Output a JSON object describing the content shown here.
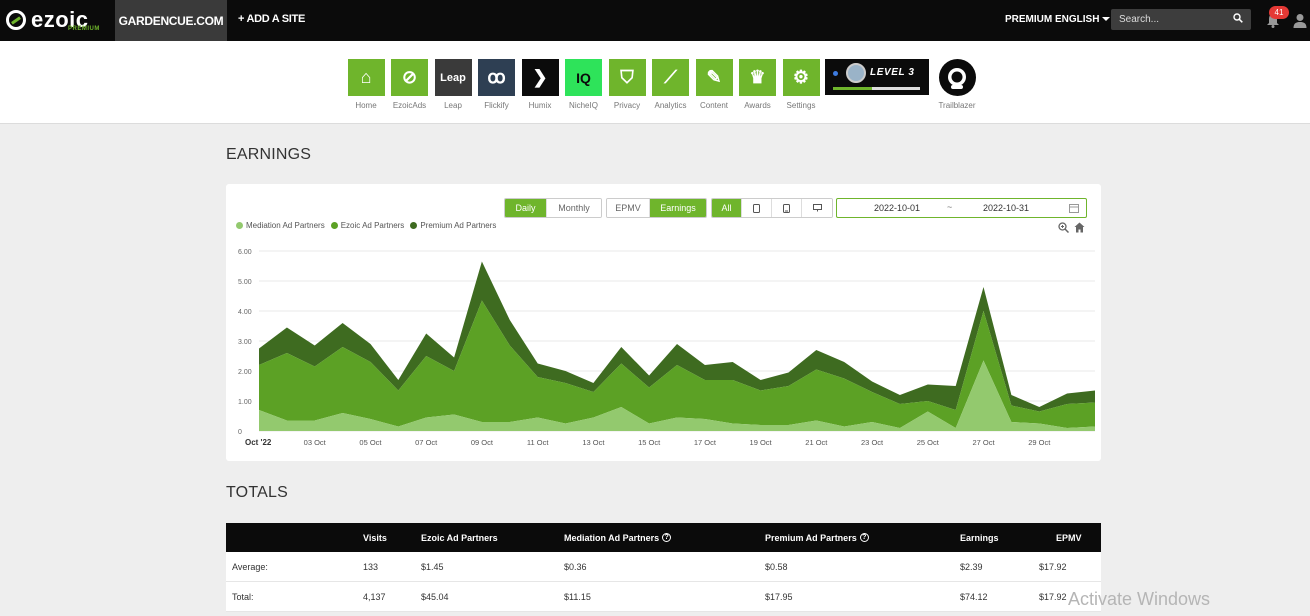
{
  "topnav": {
    "logo": "ezoic",
    "logo_sub": "PREMIUM",
    "site": "GARDENCUE.COM",
    "add_site": "+ ADD A SITE",
    "premium": "PREMIUM",
    "language": "ENGLISH",
    "search_placeholder": "Search...",
    "notification_count": "41"
  },
  "apps": [
    {
      "name": "home",
      "label": "Home",
      "glyph": "⌂",
      "bg": "#6fb52c"
    },
    {
      "name": "ezoicads",
      "label": "EzoicAds",
      "glyph": "⊘",
      "bg": "#6fb52c"
    },
    {
      "name": "leap",
      "label": "Leap",
      "glyph": "Leap",
      "bg": "#3a3a3a"
    },
    {
      "name": "flickify",
      "label": "Flickify",
      "glyph": "ꝏ",
      "bg": "#2e3f53"
    },
    {
      "name": "humix",
      "label": "Humix",
      "glyph": "❯",
      "bg": "#0b0b0b"
    },
    {
      "name": "nicheiq",
      "label": "NicheIQ",
      "glyph": "IQ",
      "bg": "#2ee35a"
    },
    {
      "name": "privacy",
      "label": "Privacy",
      "glyph": "⛉",
      "bg": "#6fb52c"
    },
    {
      "name": "analytics",
      "label": "Analytics",
      "glyph": "⟋",
      "bg": "#6fb52c"
    },
    {
      "name": "content",
      "label": "Content",
      "glyph": "✎",
      "bg": "#6fb52c"
    },
    {
      "name": "awards",
      "label": "Awards",
      "glyph": "♛",
      "bg": "#6fb52c"
    },
    {
      "name": "settings",
      "label": "Settings",
      "glyph": "⚙",
      "bg": "#6fb52c"
    }
  ],
  "level": {
    "text": "LEVEL 3",
    "progress": 0.45
  },
  "trailblazer": {
    "label": "Trailblazer"
  },
  "earnings_heading": "EARNINGS",
  "totals_heading": "TOTALS",
  "controls": {
    "period": [
      {
        "label": "Daily",
        "active": true
      },
      {
        "label": "Monthly",
        "active": false
      }
    ],
    "metric": [
      {
        "label": "EPMV",
        "active": false
      },
      {
        "label": "Earnings",
        "active": true
      }
    ],
    "device": [
      {
        "label": "All",
        "active": true
      },
      {
        "label": "tablet-icon",
        "active": false
      },
      {
        "label": "mobile-icon",
        "active": false
      },
      {
        "label": "desktop-icon",
        "active": false
      }
    ],
    "date_from": "2022-10-01",
    "date_sep": "~",
    "date_to": "2022-10-31"
  },
  "colors": {
    "brand_green": "#6fb52c",
    "mediation": "#93c96e",
    "ezoic": "#5ca125",
    "premium": "#3e6b20"
  },
  "chart_data": {
    "type": "area",
    "stacked": true,
    "x": [
      "2022-10-01",
      "2022-10-02",
      "2022-10-03",
      "2022-10-04",
      "2022-10-05",
      "2022-10-06",
      "2022-10-07",
      "2022-10-08",
      "2022-10-09",
      "2022-10-10",
      "2022-10-11",
      "2022-10-12",
      "2022-10-13",
      "2022-10-14",
      "2022-10-15",
      "2022-10-16",
      "2022-10-17",
      "2022-10-18",
      "2022-10-19",
      "2022-10-20",
      "2022-10-21",
      "2022-10-22",
      "2022-10-23",
      "2022-10-24",
      "2022-10-25",
      "2022-10-26",
      "2022-10-27",
      "2022-10-28",
      "2022-10-29",
      "2022-10-30",
      "2022-10-31"
    ],
    "x_tick_labels": [
      {
        "x": "2022-10-01",
        "label": "Oct '22"
      },
      {
        "x": "2022-10-03",
        "label": "03 Oct"
      },
      {
        "x": "2022-10-05",
        "label": "05 Oct"
      },
      {
        "x": "2022-10-07",
        "label": "07 Oct"
      },
      {
        "x": "2022-10-09",
        "label": "09 Oct"
      },
      {
        "x": "2022-10-11",
        "label": "11 Oct"
      },
      {
        "x": "2022-10-13",
        "label": "13 Oct"
      },
      {
        "x": "2022-10-15",
        "label": "15 Oct"
      },
      {
        "x": "2022-10-17",
        "label": "17 Oct"
      },
      {
        "x": "2022-10-19",
        "label": "19 Oct"
      },
      {
        "x": "2022-10-21",
        "label": "21 Oct"
      },
      {
        "x": "2022-10-23",
        "label": "23 Oct"
      },
      {
        "x": "2022-10-25",
        "label": "25 Oct"
      },
      {
        "x": "2022-10-27",
        "label": "27 Oct"
      },
      {
        "x": "2022-10-29",
        "label": "29 Oct"
      }
    ],
    "y_ticks": [
      "0",
      "1.00",
      "2.00",
      "3.00",
      "4.00",
      "5.00",
      "6.00"
    ],
    "ylim": [
      0,
      6
    ],
    "grid": true,
    "legend_position": "top-left",
    "series": [
      {
        "name": "Mediation Ad Partners",
        "color": "#93c96e",
        "values": [
          0.7,
          0.35,
          0.35,
          0.6,
          0.4,
          0.15,
          0.45,
          0.55,
          0.3,
          0.3,
          0.45,
          0.25,
          0.45,
          0.8,
          0.25,
          0.45,
          0.4,
          0.25,
          0.2,
          0.2,
          0.35,
          0.15,
          0.3,
          0.1,
          0.65,
          0.1,
          2.35,
          0.3,
          0.25,
          0.1,
          0.15
        ]
      },
      {
        "name": "Ezoic Ad Partners",
        "color": "#5ca125",
        "values": [
          1.5,
          2.25,
          1.8,
          2.2,
          1.9,
          1.2,
          2.05,
          1.45,
          4.05,
          2.55,
          1.35,
          1.35,
          0.85,
          1.45,
          1.2,
          1.75,
          1.3,
          1.45,
          1.15,
          1.3,
          1.7,
          1.6,
          1.0,
          0.8,
          0.35,
          0.6,
          1.65,
          0.55,
          0.4,
          0.8,
          0.8
        ]
      },
      {
        "name": "Premium Ad Partners",
        "color": "#3e6b20",
        "values": [
          0.55,
          0.85,
          0.7,
          0.8,
          0.6,
          0.35,
          0.75,
          0.45,
          1.3,
          0.85,
          0.45,
          0.4,
          0.3,
          0.55,
          0.4,
          0.7,
          0.5,
          0.6,
          0.35,
          0.45,
          0.65,
          0.55,
          0.35,
          0.3,
          0.55,
          0.8,
          0.8,
          0.35,
          0.15,
          0.35,
          0.4
        ]
      }
    ]
  },
  "totals": {
    "headers": [
      "",
      "Visits",
      "Ezoic Ad Partners",
      "Mediation Ad Partners",
      "Premium Ad Partners",
      "Earnings",
      "EPMV"
    ],
    "rows": [
      [
        "Average:",
        "133",
        "$1.45",
        "$0.36",
        "$0.58",
        "$2.39",
        "$17.92"
      ],
      [
        "Total:",
        "4,137",
        "$45.04",
        "$11.15",
        "$17.95",
        "$74.12",
        "$17.92"
      ]
    ]
  },
  "watermark": "Activate Windows"
}
